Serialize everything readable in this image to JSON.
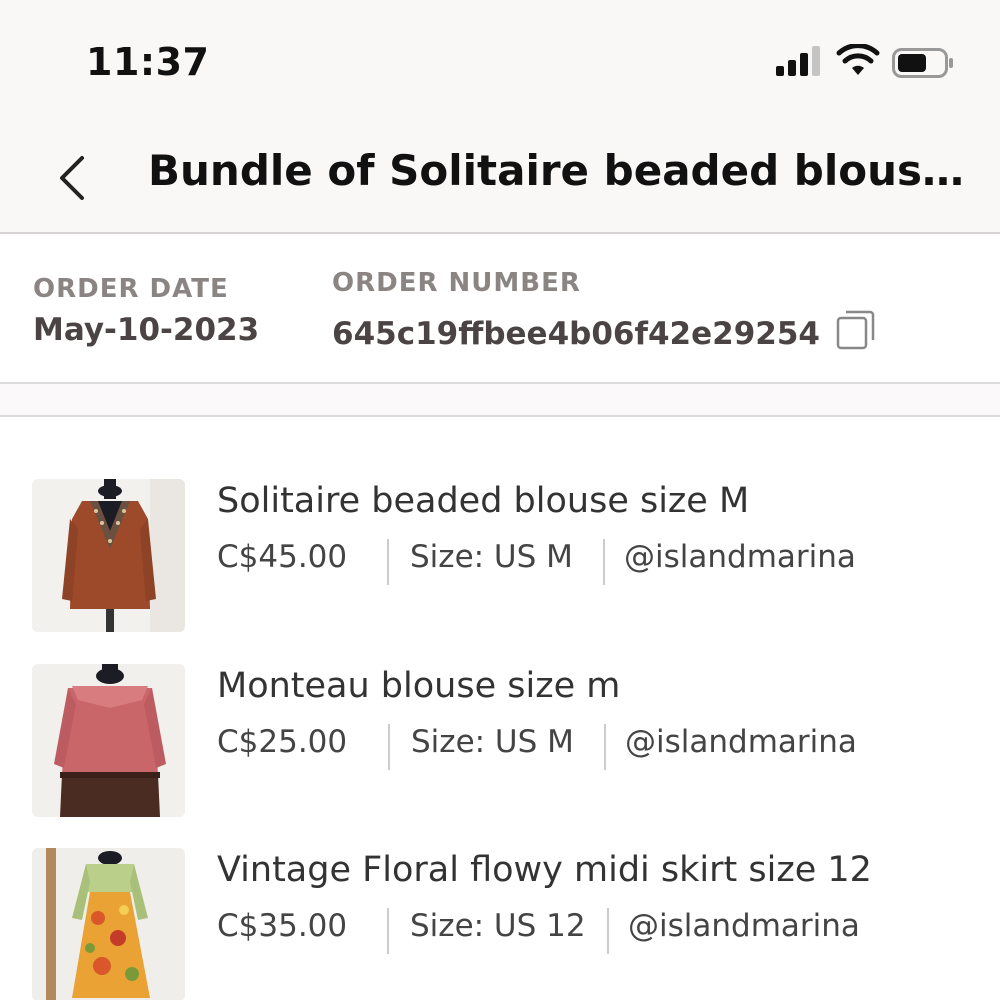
{
  "status_bar": {
    "time": "11:37"
  },
  "header": {
    "title": "Bundle of Solitaire beaded blous..."
  },
  "order": {
    "date_label": "ORDER DATE",
    "date_value": "May-10-2023",
    "number_label": "ORDER NUMBER",
    "number_value": "645c19ffbee4b06f42e29254"
  },
  "items": [
    {
      "title": "Solitaire beaded blouse size M",
      "price": "C$45.00",
      "size": "Size: US M",
      "seller": "@islandmarina"
    },
    {
      "title": "Monteau blouse size m",
      "price": "C$25.00",
      "size": "Size: US M",
      "seller": "@islandmarina"
    },
    {
      "title": "Vintage Floral flowy midi skirt size 12",
      "price": "C$35.00",
      "size": "Size: US 12",
      "seller": "@islandmarina"
    }
  ],
  "colors": {
    "header_bg": "#faf7f7",
    "label_gray": "#8a8583",
    "text_dark": "#111111"
  }
}
